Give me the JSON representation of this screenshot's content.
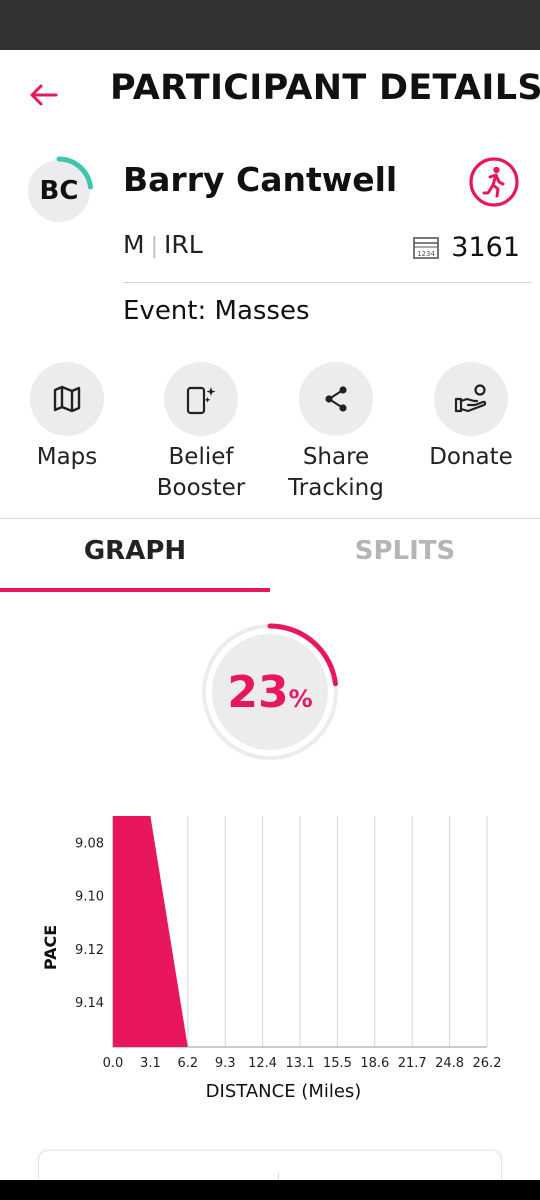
{
  "header": {
    "title": "PARTICIPANT DETAILS"
  },
  "participant": {
    "initials": "BC",
    "name": "Barry Cantwell",
    "gender": "M",
    "country": "IRL",
    "bib_number": "3161",
    "bib_icon_text": "1234",
    "event_label": "Event: Masses"
  },
  "actions": [
    {
      "label": "Maps",
      "icon": "map-icon"
    },
    {
      "label": "Belief\nBooster",
      "icon": "sparkle-phone-icon"
    },
    {
      "label": "Share\nTracking",
      "icon": "share-icon"
    },
    {
      "label": "Donate",
      "icon": "donate-hand-icon"
    }
  ],
  "tabs": [
    {
      "label": "GRAPH",
      "active": true
    },
    {
      "label": "SPLITS",
      "active": false
    }
  ],
  "progress": {
    "value": 23,
    "unit": "%"
  },
  "colors": {
    "accent": "#e8175d",
    "teal": "#3cc5b0",
    "light_gray": "#ececee"
  },
  "chart_data": {
    "type": "area",
    "xlabel": "DISTANCE (Miles)",
    "ylabel": "PACE",
    "x_ticks": [
      "0.0",
      "3.1",
      "6.2",
      "9.3",
      "12.4",
      "13.1",
      "15.5",
      "18.6",
      "21.7",
      "24.8",
      "26.2"
    ],
    "y_ticks": [
      "9.08",
      "9.10",
      "9.12",
      "9.14"
    ],
    "y_reversed": true,
    "ylim": [
      9.07,
      9.157
    ],
    "series": [
      {
        "points": [
          {
            "x_index": 0,
            "y": 9.07
          },
          {
            "x_index": 1,
            "y": 9.07
          },
          {
            "x_index": 2,
            "y": 9.157
          }
        ]
      }
    ],
    "grid": "vertical"
  }
}
